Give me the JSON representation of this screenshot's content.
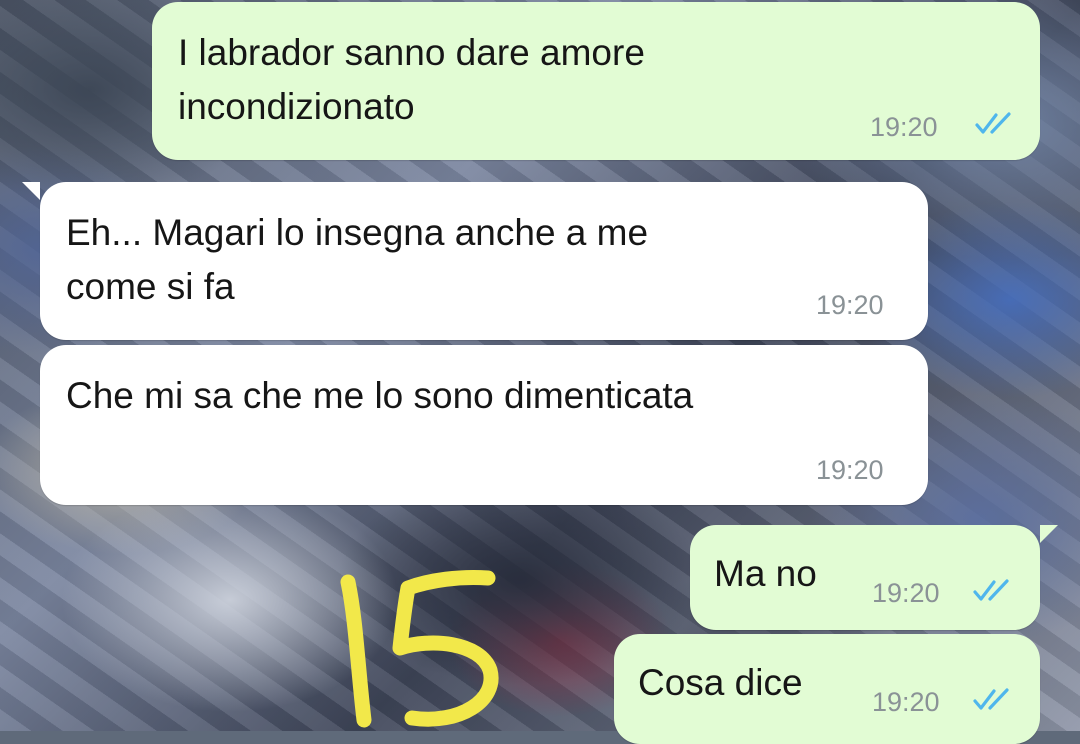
{
  "messages": [
    {
      "direction": "outgoing",
      "text": "I labrador sanno dare amore\nincondizionato",
      "time": "19:20",
      "status": "read",
      "status_icon": "double-check-icon"
    },
    {
      "direction": "incoming",
      "text": "Eh... Magari lo insegna anche a me\ncome si fa",
      "time": "19:20"
    },
    {
      "direction": "incoming",
      "text": "Che mi sa che me lo sono dimenticata",
      "time": "19:20"
    },
    {
      "direction": "outgoing",
      "text": "Ma no",
      "time": "19:20",
      "status": "read",
      "status_icon": "double-check-icon"
    },
    {
      "direction": "outgoing",
      "text": "Cosa dice",
      "time": "19:20",
      "status": "read",
      "status_icon": "double-check-icon"
    }
  ],
  "annotation": {
    "text": "15",
    "color": "#f2e84a"
  },
  "colors": {
    "outgoing_bubble": "#e2fcd4",
    "incoming_bubble": "#ffffff",
    "read_ticks": "#4fb6ec",
    "timestamp": "#8a9296"
  }
}
